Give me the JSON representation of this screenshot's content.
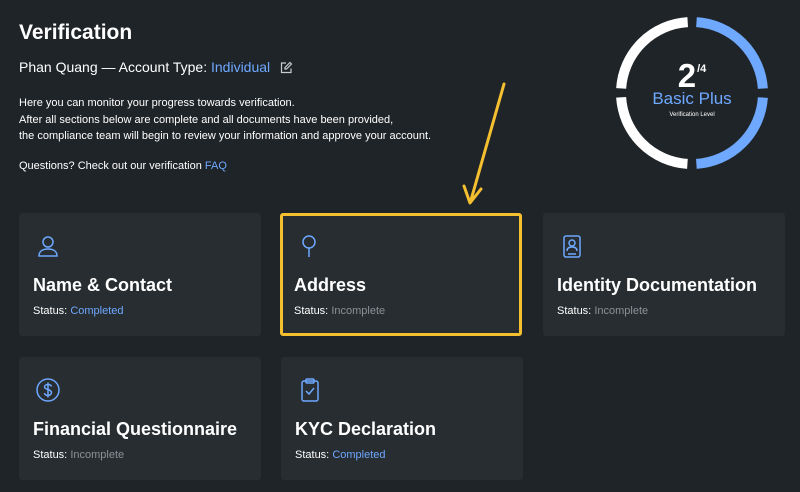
{
  "page": {
    "title": "Verification",
    "user_name": "Phan Quang",
    "account_type_prefix": "— Account Type:",
    "account_type": "Individual",
    "intro_lines": [
      "Here you can monitor your progress towards verification.",
      "After all sections below are complete and all documents have been provided,",
      "the compliance team will begin to review your information and approve your account."
    ],
    "questions_text": "Questions? Check out our verification",
    "faq_link": "FAQ"
  },
  "gauge": {
    "current": "2",
    "total": "/4",
    "level_name": "Basic Plus",
    "level_caption": "Verification Level",
    "progress": 0.5,
    "color_active": "#6ea8ff",
    "color_track": "#ffffff"
  },
  "status_label": "Status:",
  "cards": [
    {
      "title": "Name & Contact",
      "status": "Completed",
      "icon": "user-icon"
    },
    {
      "title": "Address",
      "status": "Incomplete",
      "icon": "location-pin-icon"
    },
    {
      "title": "Identity Documentation",
      "status": "Incomplete",
      "icon": "id-document-icon"
    },
    {
      "title": "Financial Questionnaire",
      "status": "Incomplete",
      "icon": "dollar-circle-icon"
    },
    {
      "title": "KYC Declaration",
      "status": "Completed",
      "icon": "clipboard-check-icon"
    }
  ],
  "colors": {
    "background": "#1f2428",
    "card": "#272d31",
    "link": "#6ea8ff",
    "highlight": "#f4c030",
    "muted": "#8c9196"
  }
}
